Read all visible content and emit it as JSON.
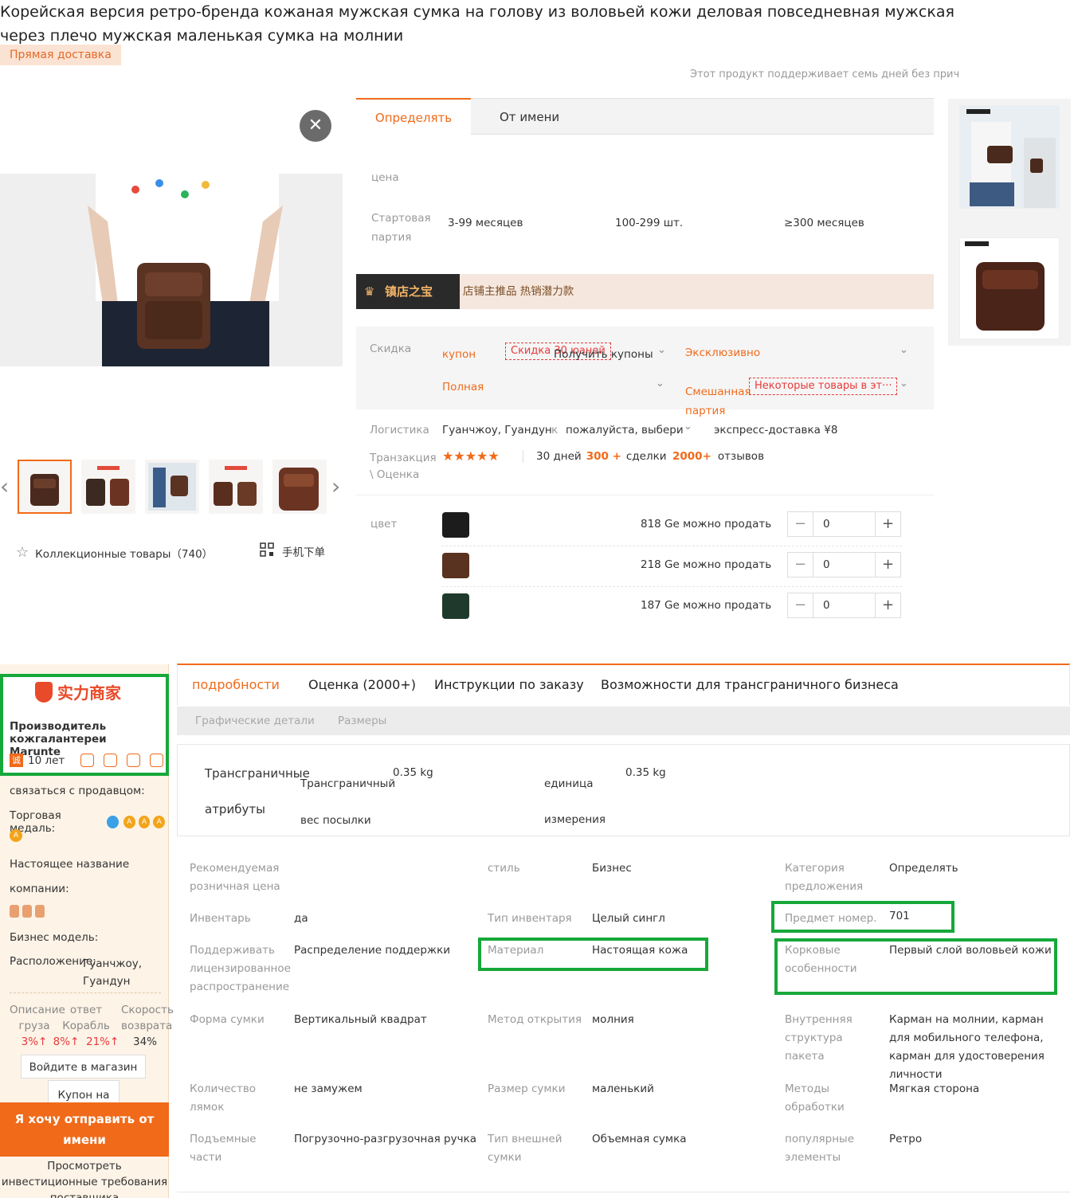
{
  "product": {
    "title": "Корейская версия ретро-бренда кожаная мужская сумка на голову из воловьей кожи деловая повседневная мужская через плечо мужская маленькая сумка на молнии",
    "badge": "Прямая доставка",
    "policy": "Этот продукт поддерживает семь дней без прич"
  },
  "gallery": {
    "close_icon": "close-icon",
    "fav_label": "Коллекционные товары（740）",
    "mobile_label": "手机下单"
  },
  "order_tabs": {
    "active": "Определять",
    "other": "От имени"
  },
  "pricing": {
    "price_label": "цена",
    "batch_label": "Стартовая партия",
    "tiers": [
      "3-99 месяцев",
      "100-299 шт.",
      "≥300 месяцев"
    ]
  },
  "store_banner": {
    "logo": "镇店之宝",
    "text": "店铺主推品 热销潜力款"
  },
  "discount": {
    "label": "Скидка",
    "coupon": "купон",
    "coupon_tag": "Скидка 30 юаней",
    "coupon_link": "Получить купоны",
    "exclusive": "Эксклюзивно",
    "full": "Полная",
    "mixed": "Смешанная партия",
    "mixed_tag": "Некоторые товары в эт···"
  },
  "logistics": {
    "label": "Логистика",
    "from": "Гуанчжоу, Гуандун",
    "to_prefix": "к",
    "to": "пожалуйста, выбери",
    "delivery": "экспресс-доставка ¥8"
  },
  "transaction": {
    "label": "Транзакция \\ Оценка",
    "stars": "★★★★★",
    "days": "30 дней",
    "deals_num": "300 +",
    "deals_label": "сделки",
    "reviews_num": "2000+",
    "reviews_label": "отзывов"
  },
  "colors": {
    "label": "цвет",
    "rows": [
      {
        "stock": "818 Ge можно продать",
        "qty": "0",
        "swatch": "#1c1c1c"
      },
      {
        "stock": "218 Ge можно продать",
        "qty": "0",
        "swatch": "#5a3220"
      },
      {
        "stock": "187 Ge можно продать",
        "qty": "0",
        "swatch": "#1f3a2c"
      }
    ]
  },
  "seller": {
    "logo_text": "实力商家",
    "name": "Производитель кожгалантереи Marunte",
    "years": "10 лет",
    "contact": "связаться с продавцом:",
    "medal_label": "Торговая медаль:",
    "real_name_label": "Настоящее название",
    "company_label": "компании:",
    "business_label": "Бизнес модель:",
    "location_label": "Расположение:",
    "location": "Гуанчжоу, Гуандун",
    "stats": [
      {
        "label": "Описание груза",
        "value": "3%↑"
      },
      {
        "label": "ответ Корабль",
        "value": "8%↑"
      },
      {
        "label": "Скорость возврата",
        "value": "21%↑"
      },
      {
        "label": "",
        "value": "34%"
      }
    ],
    "enter_store": "Войдите в магазин",
    "coupon": "Купон на",
    "cta": "Я хочу отправить от имени",
    "invest": "Просмотреть инвестиционные требования поставщика"
  },
  "details": {
    "tabs": [
      "подробности",
      "Оценка (2000+)",
      "Инструкции по заказу",
      "Возможности для трансграничного бизнеса"
    ],
    "subtabs": [
      "Графические детали",
      "Размеры"
    ],
    "crossborder": {
      "title1": "Трансграничные",
      "title2": "атрибуты",
      "weight_label": "Трансграничный вес посылки",
      "weight_value": "0.35 kg",
      "unit_label1": "единица",
      "unit_label2": "измерения",
      "unit_value": "0.35 kg"
    },
    "attributes": [
      {
        "label": "Рекомендуемая розничная цена",
        "value": ""
      },
      {
        "label": "стиль",
        "value": "Бизнес"
      },
      {
        "label": "Категория предложения",
        "value": "Определять"
      },
      {
        "label": "Инвентарь",
        "value": "да"
      },
      {
        "label": "Тип инвентаря",
        "value": "Целый сингл"
      },
      {
        "label": "Предмет номер.",
        "value": "701"
      },
      {
        "label": "Поддерживать лицензированное распространение",
        "value": "Распределение поддержки"
      },
      {
        "label": "Материал",
        "value": "Настоящая кожа"
      },
      {
        "label": "Корковые особенности",
        "value": "Первый слой воловьей кожи"
      },
      {
        "label": "Форма сумки",
        "value": "Вертикальный квадрат"
      },
      {
        "label": "Метод открытия",
        "value": "молния"
      },
      {
        "label": "Внутренняя структура пакета",
        "value": "Карман на молнии, карман для мобильного телефона, карман для удостоверения личности"
      },
      {
        "label": "Количество лямок",
        "value": "не замужем"
      },
      {
        "label": "Размер сумки",
        "value": "маленький"
      },
      {
        "label": "Методы обработки",
        "value": "Мягкая сторона"
      },
      {
        "label": "Подъемные части",
        "value": "Погрузочно-разгрузочная ручка"
      },
      {
        "label": "Тип внешней сумки",
        "value": "Объемная сумка"
      },
      {
        "label": "популярные элементы",
        "value": "Ретро"
      }
    ]
  }
}
